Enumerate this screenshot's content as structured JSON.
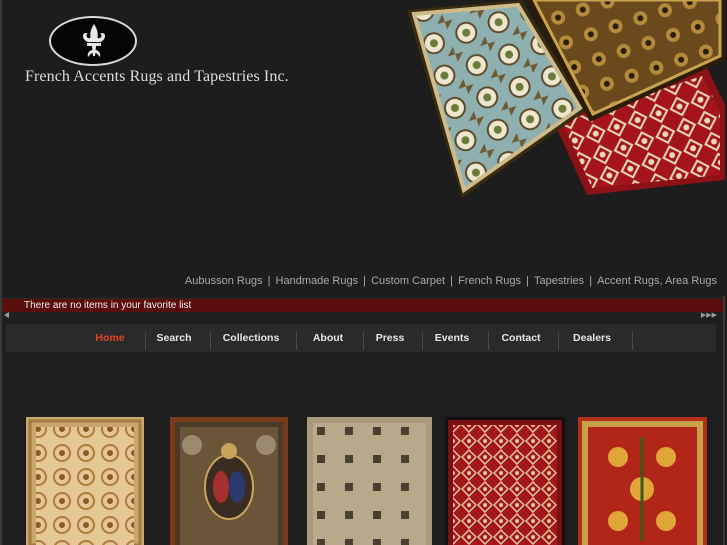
{
  "header": {
    "company_name": "French Accents Rugs and Tapestries Inc.",
    "logo_icon": "fleur-de-lis-icon",
    "tagline": [
      "Aubusson Rugs",
      "Handmade Rugs",
      "Custom Carpet",
      "French Rugs",
      "Tapestries",
      "Accent Rugs, Area Rugs"
    ]
  },
  "favorites": {
    "message": "There are no items in your favorite list"
  },
  "nav": {
    "items": [
      {
        "label": "Home",
        "active": true
      },
      {
        "label": "Search",
        "active": false
      },
      {
        "label": "Collections",
        "active": false
      },
      {
        "label": "About",
        "active": false
      },
      {
        "label": "Press",
        "active": false
      },
      {
        "label": "Events",
        "active": false
      },
      {
        "label": "Contact",
        "active": false
      },
      {
        "label": "Dealers",
        "active": false
      }
    ]
  },
  "colors": {
    "background": "#1e1e1e",
    "favorite_bar": "#5a0d0d",
    "nav_active": "#e0461d",
    "nav_text": "#e6e6e6"
  },
  "products": [
    {
      "name": "aubusson-ivory-rug"
    },
    {
      "name": "heraldic-tapestry"
    },
    {
      "name": "beige-grid-rug"
    },
    {
      "name": "red-lattice-rug"
    },
    {
      "name": "red-floral-rug"
    }
  ]
}
